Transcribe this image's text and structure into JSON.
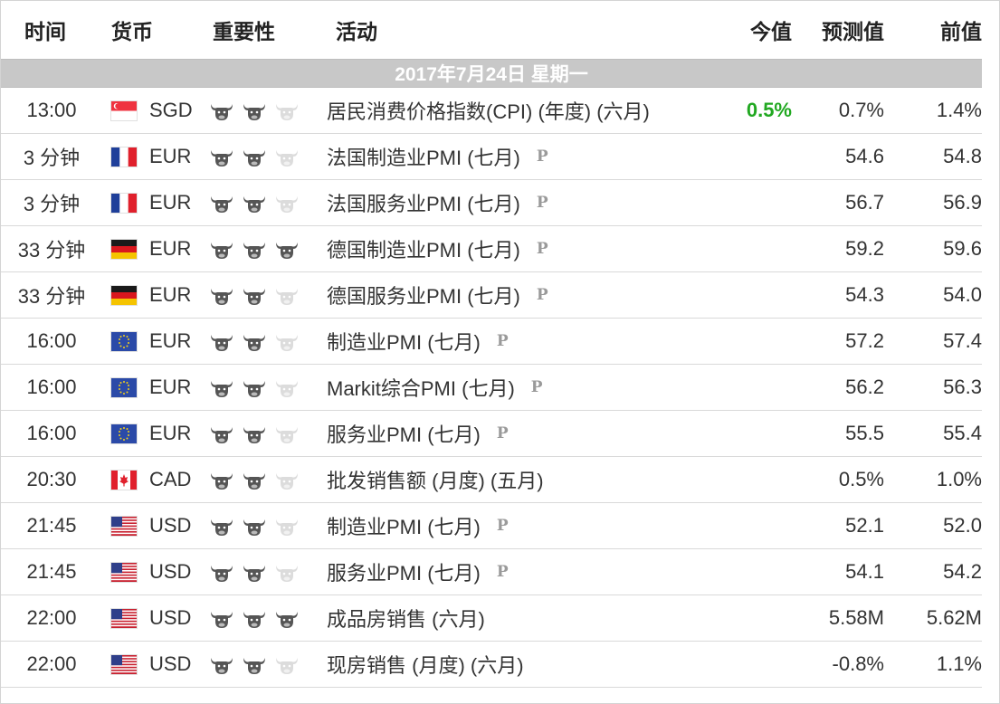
{
  "headers": {
    "time": "时间",
    "currency": "货币",
    "importance": "重要性",
    "event": "活动",
    "actual": "今值",
    "forecast": "预测值",
    "previous": "前值"
  },
  "date_label": "2017年7月24日  星期一",
  "events": [
    {
      "time": "13:00",
      "flag": "sg-flag-icon",
      "currency": "SGD",
      "importance": 2,
      "event": "居民消费价格指数(CPI) (年度) (六月)",
      "preliminary": false,
      "actual": "0.5%",
      "forecast": "0.7%",
      "previous": "1.4%"
    },
    {
      "time": "3 分钟",
      "flag": "fr-flag-icon",
      "currency": "EUR",
      "importance": 2,
      "event": "法国制造业PMI (七月)",
      "preliminary": true,
      "actual": "",
      "forecast": "54.6",
      "previous": "54.8"
    },
    {
      "time": "3 分钟",
      "flag": "fr-flag-icon",
      "currency": "EUR",
      "importance": 2,
      "event": "法国服务业PMI (七月)",
      "preliminary": true,
      "actual": "",
      "forecast": "56.7",
      "previous": "56.9"
    },
    {
      "time": "33 分钟",
      "flag": "de-flag-icon",
      "currency": "EUR",
      "importance": 3,
      "event": "德国制造业PMI (七月)",
      "preliminary": true,
      "actual": "",
      "forecast": "59.2",
      "previous": "59.6"
    },
    {
      "time": "33 分钟",
      "flag": "de-flag-icon",
      "currency": "EUR",
      "importance": 2,
      "event": "德国服务业PMI (七月)",
      "preliminary": true,
      "actual": "",
      "forecast": "54.3",
      "previous": "54.0"
    },
    {
      "time": "16:00",
      "flag": "eu-flag-icon",
      "currency": "EUR",
      "importance": 2,
      "event": "制造业PMI (七月)",
      "preliminary": true,
      "actual": "",
      "forecast": "57.2",
      "previous": "57.4"
    },
    {
      "time": "16:00",
      "flag": "eu-flag-icon",
      "currency": "EUR",
      "importance": 2,
      "event": "Markit综合PMI (七月)",
      "preliminary": true,
      "actual": "",
      "forecast": "56.2",
      "previous": "56.3"
    },
    {
      "time": "16:00",
      "flag": "eu-flag-icon",
      "currency": "EUR",
      "importance": 2,
      "event": "服务业PMI (七月)",
      "preliminary": true,
      "actual": "",
      "forecast": "55.5",
      "previous": "55.4"
    },
    {
      "time": "20:30",
      "flag": "ca-flag-icon",
      "currency": "CAD",
      "importance": 2,
      "event": "批发销售额 (月度) (五月)",
      "preliminary": false,
      "actual": "",
      "forecast": "0.5%",
      "previous": "1.0%"
    },
    {
      "time": "21:45",
      "flag": "us-flag-icon",
      "currency": "USD",
      "importance": 2,
      "event": "制造业PMI (七月)",
      "preliminary": true,
      "actual": "",
      "forecast": "52.1",
      "previous": "52.0"
    },
    {
      "time": "21:45",
      "flag": "us-flag-icon",
      "currency": "USD",
      "importance": 2,
      "event": "服务业PMI (七月)",
      "preliminary": true,
      "actual": "",
      "forecast": "54.1",
      "previous": "54.2"
    },
    {
      "time": "22:00",
      "flag": "us-flag-icon",
      "currency": "USD",
      "importance": 3,
      "event": "成品房销售 (六月)",
      "preliminary": false,
      "actual": "",
      "forecast": "5.58M",
      "previous": "5.62M"
    },
    {
      "time": "22:00",
      "flag": "us-flag-icon",
      "currency": "USD",
      "importance": 2,
      "event": "现房销售 (月度) (六月)",
      "preliminary": false,
      "actual": "",
      "forecast": "-0.8%",
      "previous": "1.1%"
    }
  ],
  "colors": {
    "actual_positive": "#21a821",
    "date_bar": "#c8c8c8",
    "bull_active": "#555555",
    "bull_inactive": "#dcdcdc"
  }
}
